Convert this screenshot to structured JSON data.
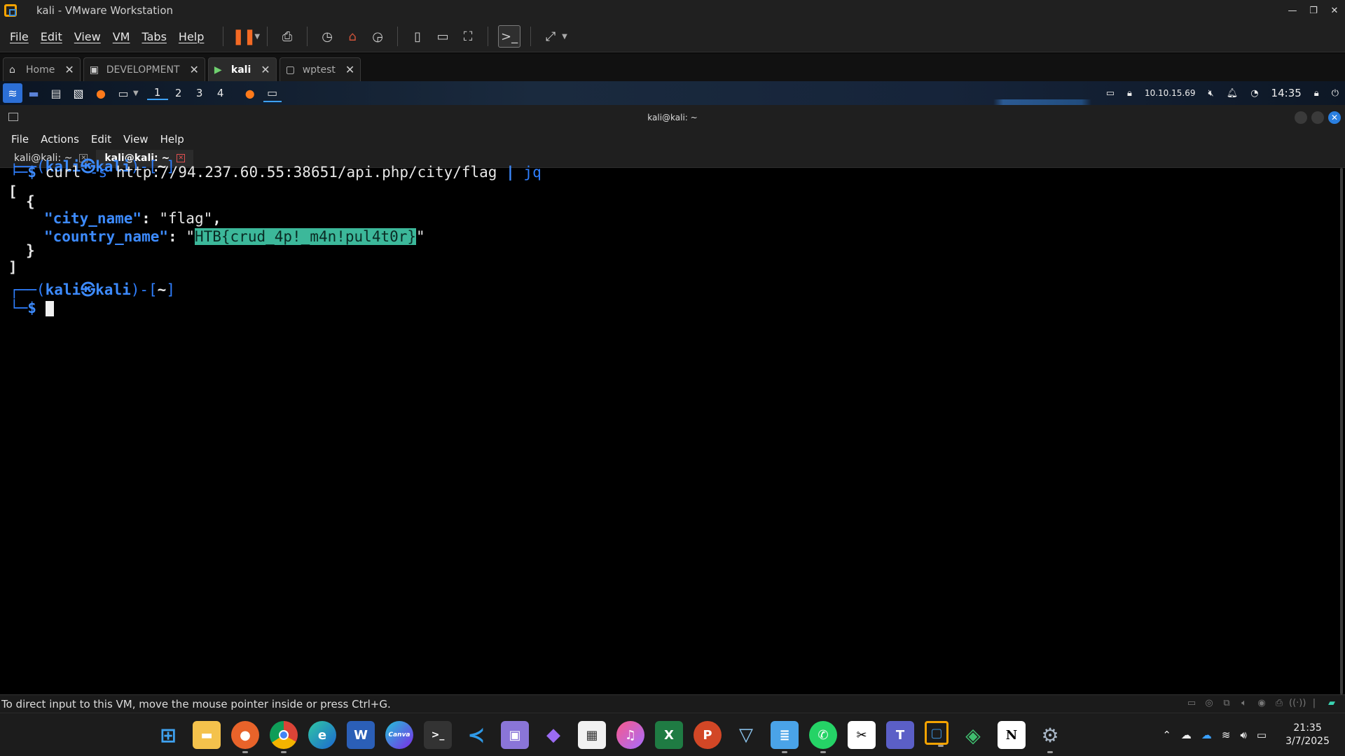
{
  "vmware": {
    "title": "kali - VMware Workstation",
    "menu": [
      "File",
      "Edit",
      "View",
      "VM",
      "Tabs",
      "Help"
    ],
    "tabs": [
      {
        "label": "Home",
        "icon": "home-icon"
      },
      {
        "label": "DEVELOPMENT",
        "icon": "vm-icon"
      },
      {
        "label": "kali",
        "icon": "vm-running-icon",
        "active": true
      },
      {
        "label": "wptest",
        "icon": "vm-icon"
      }
    ],
    "status_text": "To direct input to this VM, move the mouse pointer inside or press Ctrl+G."
  },
  "kali_panel": {
    "workspaces": [
      "1",
      "2",
      "3",
      "4"
    ],
    "ip": "10.10.15.69",
    "time": "14:35"
  },
  "terminal": {
    "title": "kali@kali: ~",
    "menu": [
      "File",
      "Actions",
      "Edit",
      "View",
      "Help"
    ],
    "tabs": [
      {
        "label": "kali@kali: ~",
        "active": false
      },
      {
        "label": "kali@kali: ~",
        "active": true
      }
    ],
    "prompt_user": "kali",
    "prompt_host": "kali",
    "prompt_dir": "~",
    "command_bin": "curl",
    "command_flag": "-s",
    "command_url": "http://94.237.60.55:38651/api.php/city/flag",
    "command_pipe": "|",
    "command_jq": "jq",
    "out_open_bracket": "[",
    "out_open_brace": "{",
    "key_city": "\"city_name\"",
    "val_city": "\"flag\"",
    "key_country": "\"country_name\"",
    "val_country_flag": "HTB{crud_4p!_m4n!pul4t0r}",
    "out_close_brace": "}",
    "out_close_bracket": "]"
  },
  "taskbar": {
    "clock_time": "21:35",
    "clock_date": "3/7/2025",
    "apps": [
      {
        "name": "windows-start",
        "label": ""
      },
      {
        "name": "file-explorer",
        "label": ""
      },
      {
        "name": "firefox",
        "label": ""
      },
      {
        "name": "chrome",
        "label": ""
      },
      {
        "name": "edge",
        "label": ""
      },
      {
        "name": "word",
        "label": "W"
      },
      {
        "name": "canva",
        "label": "Canva"
      },
      {
        "name": "terminal",
        "label": ">_"
      },
      {
        "name": "vscode",
        "label": ""
      },
      {
        "name": "app-purple",
        "label": ""
      },
      {
        "name": "obsidian",
        "label": ""
      },
      {
        "name": "ms-store",
        "label": ""
      },
      {
        "name": "itunes",
        "label": ""
      },
      {
        "name": "excel",
        "label": "X"
      },
      {
        "name": "powerpoint",
        "label": "P"
      },
      {
        "name": "protonvpn",
        "label": ""
      },
      {
        "name": "notepad",
        "label": ""
      },
      {
        "name": "whatsapp",
        "label": ""
      },
      {
        "name": "capcut",
        "label": ""
      },
      {
        "name": "teams",
        "label": "T"
      },
      {
        "name": "vmware",
        "label": ""
      },
      {
        "name": "app-green",
        "label": ""
      },
      {
        "name": "notion",
        "label": "N"
      },
      {
        "name": "settings",
        "label": ""
      }
    ]
  }
}
